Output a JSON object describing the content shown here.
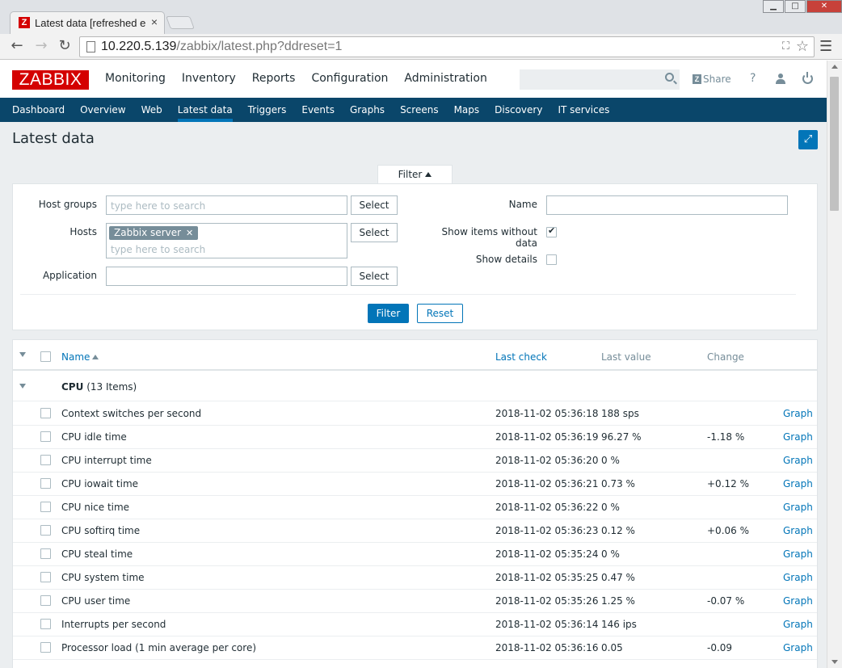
{
  "browser": {
    "tab_title": "Latest data [refreshed e",
    "tab_favicon": "Z",
    "tab_close": "×",
    "url_host": "10.220.5.139",
    "url_rest": "/zabbix/latest.php?ddreset=1",
    "window_buttons": [
      "▁",
      "□",
      "✕"
    ]
  },
  "header": {
    "logo": "ZABBIX",
    "nav": [
      "Monitoring",
      "Inventory",
      "Reports",
      "Configuration",
      "Administration"
    ],
    "search_placeholder": "",
    "share_label": "Share",
    "share_icon": "Z",
    "help_label": "?"
  },
  "subnav": [
    "Dashboard",
    "Overview",
    "Web",
    "Latest data",
    "Triggers",
    "Events",
    "Graphs",
    "Screens",
    "Maps",
    "Discovery",
    "IT services"
  ],
  "page": {
    "title": "Latest data",
    "fullscreen_icon": "⤢"
  },
  "filter": {
    "tab_label": "Filter",
    "host_groups_label": "Host groups",
    "hosts_label": "Hosts",
    "application_label": "Application",
    "name_label": "Name",
    "show_items_label": "Show items without data",
    "show_details_label": "Show details",
    "search_placeholder": "type here to search",
    "select_label": "Select",
    "host_chip": "Zabbix server",
    "chip_remove": "✕",
    "filter_button": "Filter",
    "reset_button": "Reset",
    "show_items_checked": true,
    "show_details_checked": false
  },
  "table": {
    "columns": {
      "name": "Name",
      "last_check": "Last check",
      "last_value": "Last value",
      "change": "Change"
    },
    "group": {
      "name": "CPU",
      "count": "(13 Items)"
    },
    "graph_label": "Graph",
    "rows": [
      {
        "name": "Context switches per second",
        "last_check": "2018-11-02 05:36:18",
        "last_value": "188 sps",
        "change": ""
      },
      {
        "name": "CPU idle time",
        "last_check": "2018-11-02 05:36:19",
        "last_value": "96.27 %",
        "change": "-1.18 %"
      },
      {
        "name": "CPU interrupt time",
        "last_check": "2018-11-02 05:36:20",
        "last_value": "0 %",
        "change": ""
      },
      {
        "name": "CPU iowait time",
        "last_check": "2018-11-02 05:36:21",
        "last_value": "0.73 %",
        "change": "+0.12 %"
      },
      {
        "name": "CPU nice time",
        "last_check": "2018-11-02 05:36:22",
        "last_value": "0 %",
        "change": ""
      },
      {
        "name": "CPU softirq time",
        "last_check": "2018-11-02 05:36:23",
        "last_value": "0.12 %",
        "change": "+0.06 %"
      },
      {
        "name": "CPU steal time",
        "last_check": "2018-11-02 05:35:24",
        "last_value": "0 %",
        "change": ""
      },
      {
        "name": "CPU system time",
        "last_check": "2018-11-02 05:35:25",
        "last_value": "0.47 %",
        "change": ""
      },
      {
        "name": "CPU user time",
        "last_check": "2018-11-02 05:35:26",
        "last_value": "1.25 %",
        "change": "-0.07 %"
      },
      {
        "name": "Interrupts per second",
        "last_check": "2018-11-02 05:36:14",
        "last_value": "146 ips",
        "change": ""
      },
      {
        "name": "Processor load (1 min average per core)",
        "last_check": "2018-11-02 05:36:16",
        "last_value": "0.05",
        "change": "-0.09"
      }
    ]
  },
  "colors": {
    "brand_red": "#d40000",
    "nav_blue": "#0a466a",
    "accent_blue": "#0275b8",
    "muted": "#768d99"
  }
}
